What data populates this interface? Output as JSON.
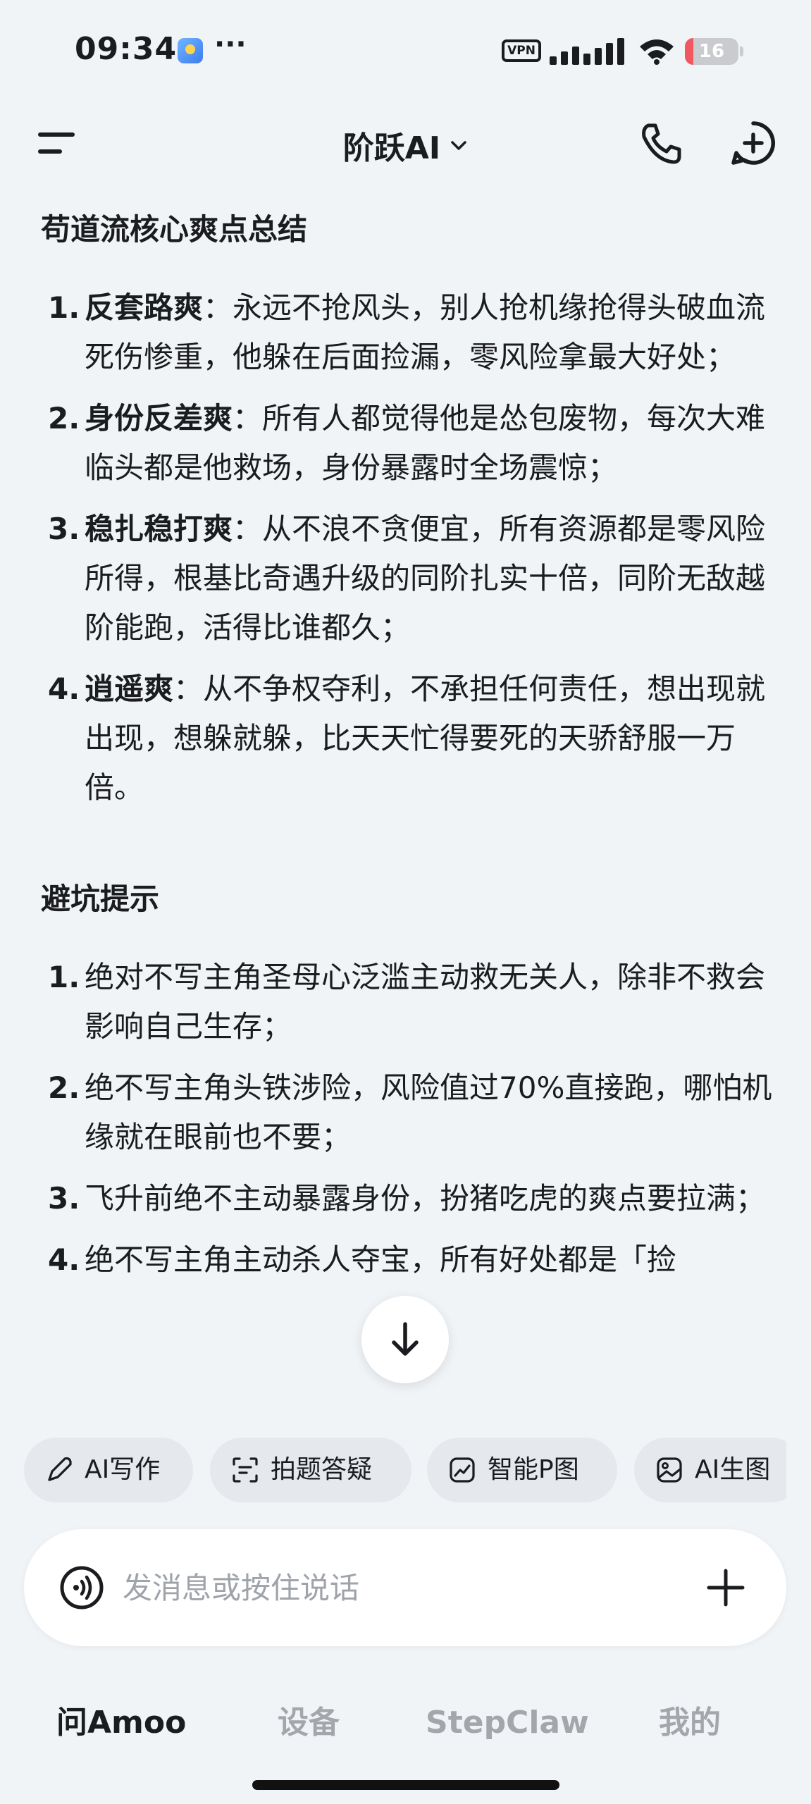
{
  "status_bar": {
    "time": "09:34",
    "more": "···",
    "vpn": "VPN",
    "battery": "16",
    "battery_level": 0.16,
    "icons": [
      "app-notification-icon",
      "signal-icon",
      "wifi-icon",
      "battery-icon"
    ]
  },
  "header": {
    "title": "阶跃AI",
    "icons": [
      "menu-icon",
      "chevron-down-icon",
      "phone-icon",
      "new-chat-icon"
    ]
  },
  "content": {
    "section1": {
      "title": "苟道流核心爽点总结",
      "items": [
        {
          "num": "1.",
          "strong": "反套路爽",
          "text": "：永远不抢风头，别人抢机缘抢得头破血流死伤惨重，他躲在后面捡漏，零风险拿最大好处；"
        },
        {
          "num": "2.",
          "strong": "身份反差爽",
          "text": "：所有人都觉得他是怂包废物，每次大难临头都是他救场，身份暴露时全场震惊；"
        },
        {
          "num": "3.",
          "strong": "稳扎稳打爽",
          "text": "：从不浪不贪便宜，所有资源都是零风险所得，根基比奇遇升级的同阶扎实十倍，同阶无敌越阶能跑，活得比谁都久；"
        },
        {
          "num": "4.",
          "strong": "逍遥爽",
          "text": "：从不争权夺利，不承担任何责任，想出现就出现，想躲就躲，比天天忙得要死的天骄舒服一万倍。"
        }
      ]
    },
    "section2": {
      "title": "避坑提示",
      "items": [
        {
          "num": "1.",
          "text": "绝对不写主角圣母心泛滥主动救无关人，除非不救会影响自己生存；"
        },
        {
          "num": "2.",
          "text": "绝不写主角头铁涉险，风险值过70%直接跑，哪怕机缘就在眼前也不要；"
        },
        {
          "num": "3.",
          "text": "飞升前绝不主动暴露身份，扮猪吃虎的爽点要拉满；"
        },
        {
          "num": "4.",
          "text": "绝不写主角主动杀人夺宝，所有好处都是「捡"
        }
      ]
    }
  },
  "chips": [
    {
      "label": "AI写作",
      "icon": "pen-icon"
    },
    {
      "label": "拍题答疑",
      "icon": "scan-icon"
    },
    {
      "label": "智能P图",
      "icon": "image-edit-icon"
    },
    {
      "label": "AI生图",
      "icon": "image-icon"
    }
  ],
  "input": {
    "placeholder": "发消息或按住说话",
    "value": "",
    "icons": [
      "voice-icon",
      "plus-icon"
    ]
  },
  "bottom_nav": {
    "items": [
      {
        "label": "问Amoo",
        "active": true
      },
      {
        "label": "设备",
        "active": false
      },
      {
        "label": "StepClaw",
        "active": false
      },
      {
        "label": "我的",
        "active": false
      }
    ]
  },
  "colors": {
    "background": "#f1f4f7",
    "text": "#1b1c1f",
    "muted": "#a3a6ab",
    "chip": "#e5e8ec",
    "battery_low": "#f25660"
  }
}
